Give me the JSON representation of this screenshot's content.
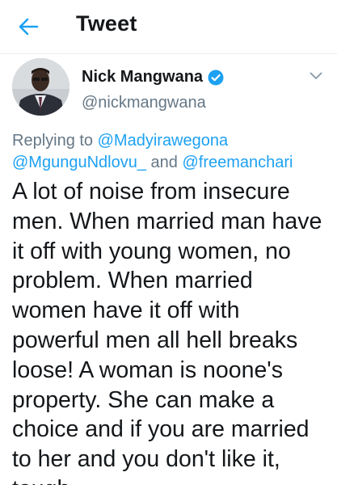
{
  "header": {
    "back_icon": "arrow-left-icon",
    "title": "Tweet"
  },
  "colors": {
    "accent": "#1da1f2",
    "secondary_text": "#657786",
    "primary_text": "#14171a"
  },
  "author": {
    "name": "Nick Mangwana",
    "handle": "@nickmangwana",
    "verified_icon": "verified-badge-icon",
    "menu_icon": "chevron-down-icon"
  },
  "reply": {
    "prefix": "Replying to ",
    "mention_1": "@Madyirawegona",
    "mention_2": "@MgunguNdlovu_",
    "connector": " and ",
    "mention_3": "@freemanchari"
  },
  "tweet": {
    "lines": [
      "A lot of noise from insecure",
      "men. When married man have",
      "it off with young women, no",
      "problem. When married",
      "women have it off with",
      "powerful men all hell breaks",
      "loose! A woman is noone's",
      "property. She can make a",
      "choice and if you are married",
      "to her and you don't like it,",
      "tough."
    ]
  }
}
